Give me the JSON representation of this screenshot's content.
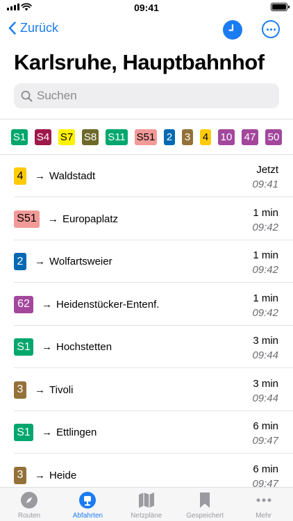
{
  "status": {
    "time": "09:41"
  },
  "nav": {
    "back_label": "Zurück"
  },
  "page": {
    "title": "Karlsruhe, Hauptbahnhof"
  },
  "search": {
    "placeholder": "Suchen"
  },
  "line_chips": [
    {
      "label": "S1",
      "bg": "#00a76d",
      "fg": "#ffffff"
    },
    {
      "label": "S4",
      "bg": "#9f184c",
      "fg": "#ffffff"
    },
    {
      "label": "S7",
      "bg": "#fff200",
      "fg": "#000000"
    },
    {
      "label": "S8",
      "bg": "#6e692a",
      "fg": "#ffffff"
    },
    {
      "label": "S11",
      "bg": "#00a76d",
      "fg": "#ffffff"
    },
    {
      "label": "S51",
      "bg": "#f29a98",
      "fg": "#000000"
    },
    {
      "label": "2",
      "bg": "#0069b4",
      "fg": "#ffffff"
    },
    {
      "label": "3",
      "bg": "#947139",
      "fg": "#ffffff"
    },
    {
      "label": "4",
      "bg": "#ffcb04",
      "fg": "#000000"
    },
    {
      "label": "10",
      "bg": "#a3479d",
      "fg": "#ffffff"
    },
    {
      "label": "47",
      "bg": "#a3479d",
      "fg": "#ffffff"
    },
    {
      "label": "50",
      "bg": "#a3479d",
      "fg": "#ffffff"
    }
  ],
  "departures": [
    {
      "line": "4",
      "bg": "#ffcb04",
      "fg": "#000000",
      "arrow": "→",
      "destination": "Waldstadt",
      "relative": "Jetzt",
      "time": "09:41"
    },
    {
      "line": "S51",
      "bg": "#f29a98",
      "fg": "#000000",
      "arrow": "→",
      "destination": "Europaplatz",
      "relative": "1 min",
      "time": "09:42"
    },
    {
      "line": "2",
      "bg": "#0069b4",
      "fg": "#ffffff",
      "arrow": "→",
      "destination": "Wolfartsweier",
      "relative": "1 min",
      "time": "09:42"
    },
    {
      "line": "62",
      "bg": "#a3479d",
      "fg": "#ffffff",
      "arrow": "→",
      "destination": "Heidenstücker-Entenf.",
      "relative": "1 min",
      "time": "09:42"
    },
    {
      "line": "S1",
      "bg": "#00a76d",
      "fg": "#ffffff",
      "arrow": "→",
      "destination": "Hochstetten",
      "relative": "3 min",
      "time": "09:44"
    },
    {
      "line": "3",
      "bg": "#947139",
      "fg": "#ffffff",
      "arrow": "→",
      "destination": "Tivoli",
      "relative": "3 min",
      "time": "09:44"
    },
    {
      "line": "S1",
      "bg": "#00a76d",
      "fg": "#ffffff",
      "arrow": "→",
      "destination": "Ettlingen",
      "relative": "6 min",
      "time": "09:47"
    },
    {
      "line": "3",
      "bg": "#947139",
      "fg": "#ffffff",
      "arrow": "→",
      "destination": "Heide",
      "relative": "6 min",
      "time": "09:47"
    }
  ],
  "tabs": [
    {
      "label": "Routen",
      "icon": "compass-icon",
      "active": false
    },
    {
      "label": "Abfahrten",
      "icon": "departures-icon",
      "active": true
    },
    {
      "label": "Netzpläne",
      "icon": "map-icon",
      "active": false
    },
    {
      "label": "Gespeichert",
      "icon": "bookmark-icon",
      "active": false
    },
    {
      "label": "Mehr",
      "icon": "more-icon",
      "active": false
    }
  ],
  "colors": {
    "accent": "#1a7cf1",
    "inactive": "#9a9aa0"
  }
}
